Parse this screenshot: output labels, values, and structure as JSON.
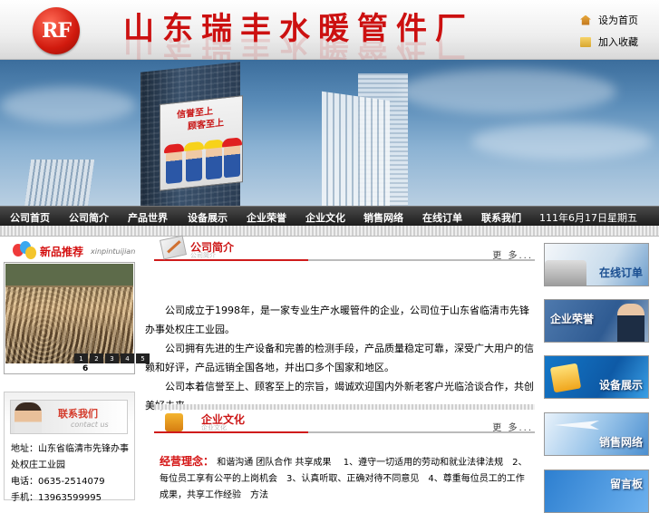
{
  "header": {
    "logo_text": "RF",
    "site_title": "山东瑞丰水暖管件厂",
    "home_link": "设为首页",
    "favorite_link": "加入收藏"
  },
  "banner": {
    "billboard_line1": "信誉至上",
    "billboard_line2": "顾客至上"
  },
  "nav": {
    "items": [
      "公司首页",
      "公司简介",
      "产品世界",
      "设备展示",
      "企业荣誉",
      "企业文化",
      "销售网络",
      "在线订单",
      "联系我们"
    ],
    "date": "111年6月17日星期五"
  },
  "new_products": {
    "title": "新品推荐",
    "pinyin": "xinpintuijian",
    "pager": [
      "1",
      "2",
      "3",
      "4",
      "5"
    ],
    "caption": "6"
  },
  "contact": {
    "title": "联系我们",
    "subtitle": "contact us",
    "address": "地址：山东省临清市先锋办事处权庄工业园",
    "phone": "电话：0635-2514079",
    "mobile": "手机：13963599995"
  },
  "intro": {
    "title": "公司简介",
    "subtitle": "公司简介",
    "more": "更 多...",
    "paragraphs": [
      "　　公司成立于1998年，是一家专业生产水暖管件的企业，公司位于山东省临清市先锋办事处权庄工业园。",
      "　　公司拥有先进的生产设备和完善的检测手段，产品质量稳定可靠，深受广大用户的信赖和好评，产品远销全国各地，并出口多个国家和地区。",
      "　　公司本着信誉至上、顾客至上的宗旨，竭诚欢迎国内外新老客户光临洽谈合作，共创美好未来。"
    ]
  },
  "culture": {
    "title": "企业文化",
    "subtitle": "企业文化",
    "more": "更 多...",
    "label": "经营理念：",
    "text": "和谐沟通 团队合作 共享成果　 1、遵守一切适用的劳动和就业法律法规　2、每位员工享有公平的上岗机会　3、认真听取、正确对待不同意见　4、尊重每位员工的工作成果，共享工作经验　方法"
  },
  "side_buttons": {
    "order": "在线订单",
    "honor": "企业荣誉",
    "equipment": "设备展示",
    "sales": "销售网络",
    "message": "留言板"
  }
}
